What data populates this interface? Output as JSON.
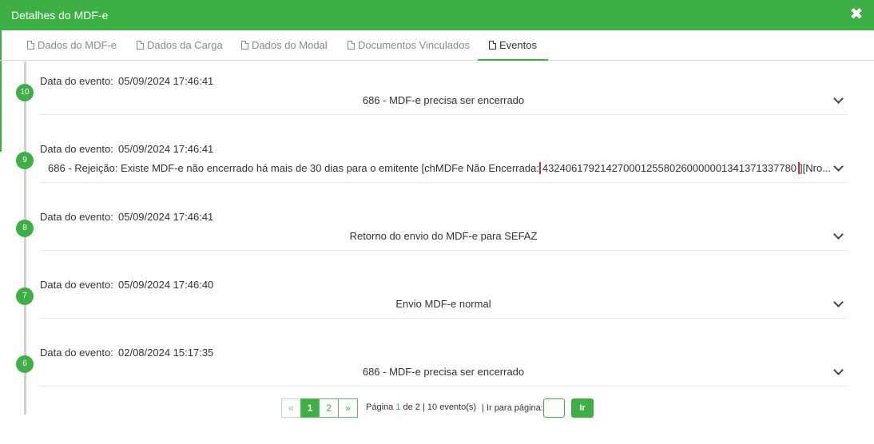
{
  "window": {
    "title": "Detalhes do MDF-e",
    "close_icon": "close-icon"
  },
  "tabs": [
    {
      "label": "Dados do MDF-e",
      "icon": "document-icon"
    },
    {
      "label": "Dados da Carga",
      "icon": "document-icon"
    },
    {
      "label": "Dados do Modal",
      "icon": "document-icon"
    },
    {
      "label": "Documentos Vinculados",
      "icon": "document-icon"
    },
    {
      "label": "Eventos",
      "icon": "document-icon",
      "active": true
    }
  ],
  "events": [
    {
      "number": "10",
      "date_label": "Data do evento:",
      "date": "05/09/2024 17:46:41",
      "description": "686 - MDF-e precisa ser encerrado"
    },
    {
      "number": "9",
      "date_label": "Data do evento:",
      "date": "05/09/2024 17:46:41",
      "description_prefix": "686 - Rejeição: Existe MDF-e não encerrado há mais de 30 dias para o emitente [chMDFe Não Encerrada:",
      "description_key": "43240617921427000125580260000001341371337780",
      "description_suffix": "][Nro..."
    },
    {
      "number": "8",
      "date_label": "Data do evento:",
      "date": "05/09/2024 17:46:41",
      "description": "Retorno do envio do MDF-e para SEFAZ"
    },
    {
      "number": "7",
      "date_label": "Data do evento:",
      "date": "05/09/2024 17:46:40",
      "description": "Envio MDF-e normal"
    },
    {
      "number": "6",
      "date_label": "Data do evento:",
      "date": "02/08/2024 15:17:35",
      "description": "686 - MDF-e precisa ser encerrado"
    }
  ],
  "pagination": {
    "prev": "«",
    "pages": [
      "1",
      "2"
    ],
    "next": "»",
    "current": "1",
    "info_prefix": "Página",
    "info_current": "1",
    "info_middle": "de 2 |",
    "info_count": "10 evento(s)",
    "goto_label": "| Ir para página:",
    "goto_value": "",
    "go_button": "Ir"
  },
  "colors": {
    "brand": "#3db045",
    "highlight": "#d32f2f"
  }
}
